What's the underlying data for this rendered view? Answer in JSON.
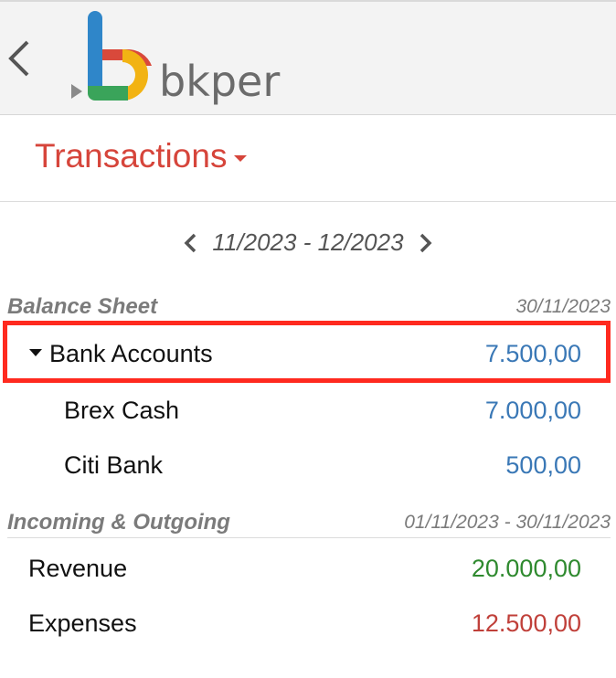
{
  "app": {
    "logo_text": "bkper"
  },
  "header": {
    "title": "Transactions"
  },
  "period": {
    "label": "11/2023 - 12/2023"
  },
  "balance_sheet": {
    "title": "Balance Sheet",
    "date": "30/11/2023",
    "group": {
      "name": "Bank Accounts",
      "amount": "7.500,00"
    },
    "accounts": [
      {
        "name": "Brex Cash",
        "amount": "7.000,00"
      },
      {
        "name": "Citi Bank",
        "amount": "500,00"
      }
    ]
  },
  "incoming_outgoing": {
    "title": "Incoming & Outgoing",
    "date": "01/11/2023 - 30/11/2023",
    "accounts": [
      {
        "name": "Revenue",
        "amount": "20.000,00"
      },
      {
        "name": "Expenses",
        "amount": "12.500,00"
      }
    ]
  },
  "colors": {
    "accent": "#d6453b",
    "asset_amount": "#3a78b6",
    "revenue_amount": "#2f8a2f",
    "expense_amount": "#c0403a",
    "highlight_border": "#ff2a1f"
  }
}
